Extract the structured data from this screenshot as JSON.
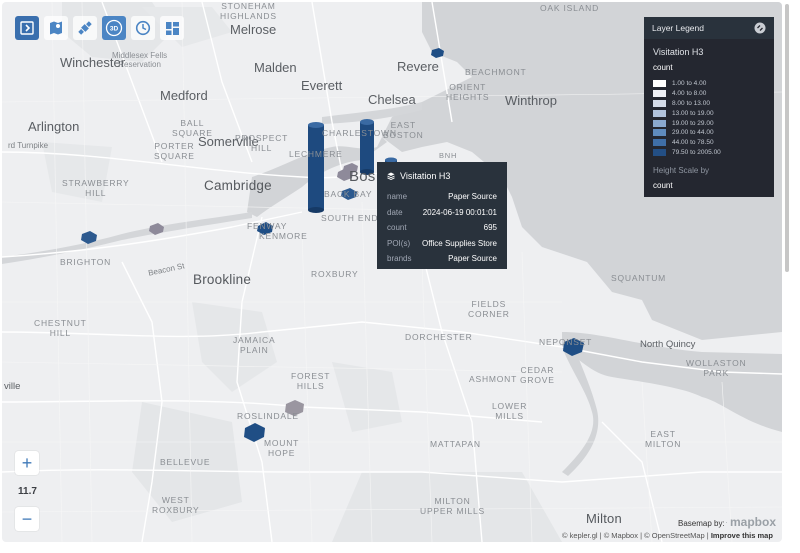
{
  "toolbar": {
    "buttons": [
      {
        "icon": "layer-panel-toggle-icon",
        "active": true
      },
      {
        "icon": "map-pin-icon",
        "active": false
      },
      {
        "icon": "satellite-icon",
        "active": false
      },
      {
        "icon": "3d-view-icon",
        "label": "3D",
        "active": true
      },
      {
        "icon": "clock-icon",
        "active": false
      },
      {
        "icon": "grid-layout-icon",
        "active": false
      }
    ]
  },
  "map": {
    "places": {
      "melrose": "Melrose",
      "malden": "Malden",
      "revere": "Revere",
      "winchester": "Winchester",
      "medford": "Medford",
      "everett": "Everett",
      "chelsea": "Chelsea",
      "winthrop": "Winthrop",
      "arlington": "Arlington",
      "somerville": "Somerville",
      "cambridge": "Cambridge",
      "boston": "Bos",
      "brookline": "Brookline",
      "milton": "Milton",
      "north_quincy": "North Quincy",
      "ville": "ville"
    },
    "neighborhoods": {
      "stoneham": "STONEHAM\nHIGHLANDS",
      "oak_island": "OAK ISLAND",
      "middlesex": "Middlesex Fells\nReservation",
      "beachmont": "BEACHMONT",
      "orient": "ORIENT\nHEIGHTS",
      "ball_square": "BALL\nSQUARE",
      "prospect": "PROSPECT\nHILL",
      "porter": "PORTER\nSQUARE",
      "east_boston": "EAST\nBOSTON",
      "charlestown": "CHARLESTOWN",
      "lechmere": "LECHMERE",
      "strawberry": "STRAWBERRY\nHILL",
      "kenmore": "KENMORE",
      "fenway": "FENWAY",
      "back_bay": "BACK BAY",
      "south_end": "SOUTH END",
      "brighton": "BRIGHTON",
      "roxbury": "ROXBURY",
      "fields": "FIELDS\nCORNER",
      "chestnut": "CHESTNUT\nHILL",
      "dorchester": "DORCHESTER",
      "neponset": "NEPONSET",
      "wollaston": "WOLLASTON\nPARK",
      "jamaica": "JAMAICA\nPLAIN",
      "forest": "FOREST\nHILLS",
      "ashmont": "ASHMONT",
      "cedar": "CEDAR\nGROVE",
      "roslindale": "ROSLINDALE",
      "lower_mills": "LOWER\nMILLS",
      "mount_hope": "MOUNT\nHOPE",
      "mattapan": "MATTAPAN",
      "east_milton": "EAST\nMILTON",
      "bellevue": "BELLEVUE",
      "west_roxbury": "WEST\nROXBURY",
      "milton_upper": "MILTON\nUPPER MILLS",
      "squantum": "SQUANTUM",
      "bnh": "BNH"
    },
    "roads": {
      "turnpike": "rd Turnpike",
      "beacon": "Beacon St"
    },
    "layer_color": "#1f4e85",
    "light_color": "#8e8a9a"
  },
  "tooltip": {
    "title": "Visitation H3",
    "rows": [
      {
        "key": "name",
        "value": "Paper Source"
      },
      {
        "key": "date",
        "value": "2024-06-19 00:01:01"
      },
      {
        "key": "count",
        "value": "695"
      },
      {
        "key": "POI(s)",
        "value": "Office Supplies Store"
      },
      {
        "key": "brands",
        "value": "Paper Source"
      }
    ]
  },
  "legend": {
    "header": "Layer Legend",
    "layer_name": "Visitation H3",
    "field": "count",
    "items": [
      {
        "label": "1.00 to 4.00",
        "color": "#ffffff"
      },
      {
        "label": "4.00 to 8.00",
        "color": "#eef0f5"
      },
      {
        "label": "8.00 to 13.00",
        "color": "#d4dbe8"
      },
      {
        "label": "13.00 to 19.00",
        "color": "#b1c3dc"
      },
      {
        "label": "19.00 to 29.00",
        "color": "#8aa9cf"
      },
      {
        "label": "29.00 to 44.00",
        "color": "#5f8bbd"
      },
      {
        "label": "44.00 to 78.50",
        "color": "#3f6fa8"
      },
      {
        "label": "79.50 to 2005.00",
        "color": "#234f85"
      }
    ],
    "height_scale_label": "Height Scale by",
    "height_scale_field": "count"
  },
  "zoom": {
    "in": "+",
    "out": "−",
    "level": "11.7"
  },
  "attribution": {
    "basemap_by": "Basemap by:",
    "logo_text": "mapbox",
    "kepler": "© kepler.gl",
    "mapbox": "© Mapbox",
    "osm": "© OpenStreetMap",
    "improve": "Improve this map",
    "sep": "|"
  }
}
